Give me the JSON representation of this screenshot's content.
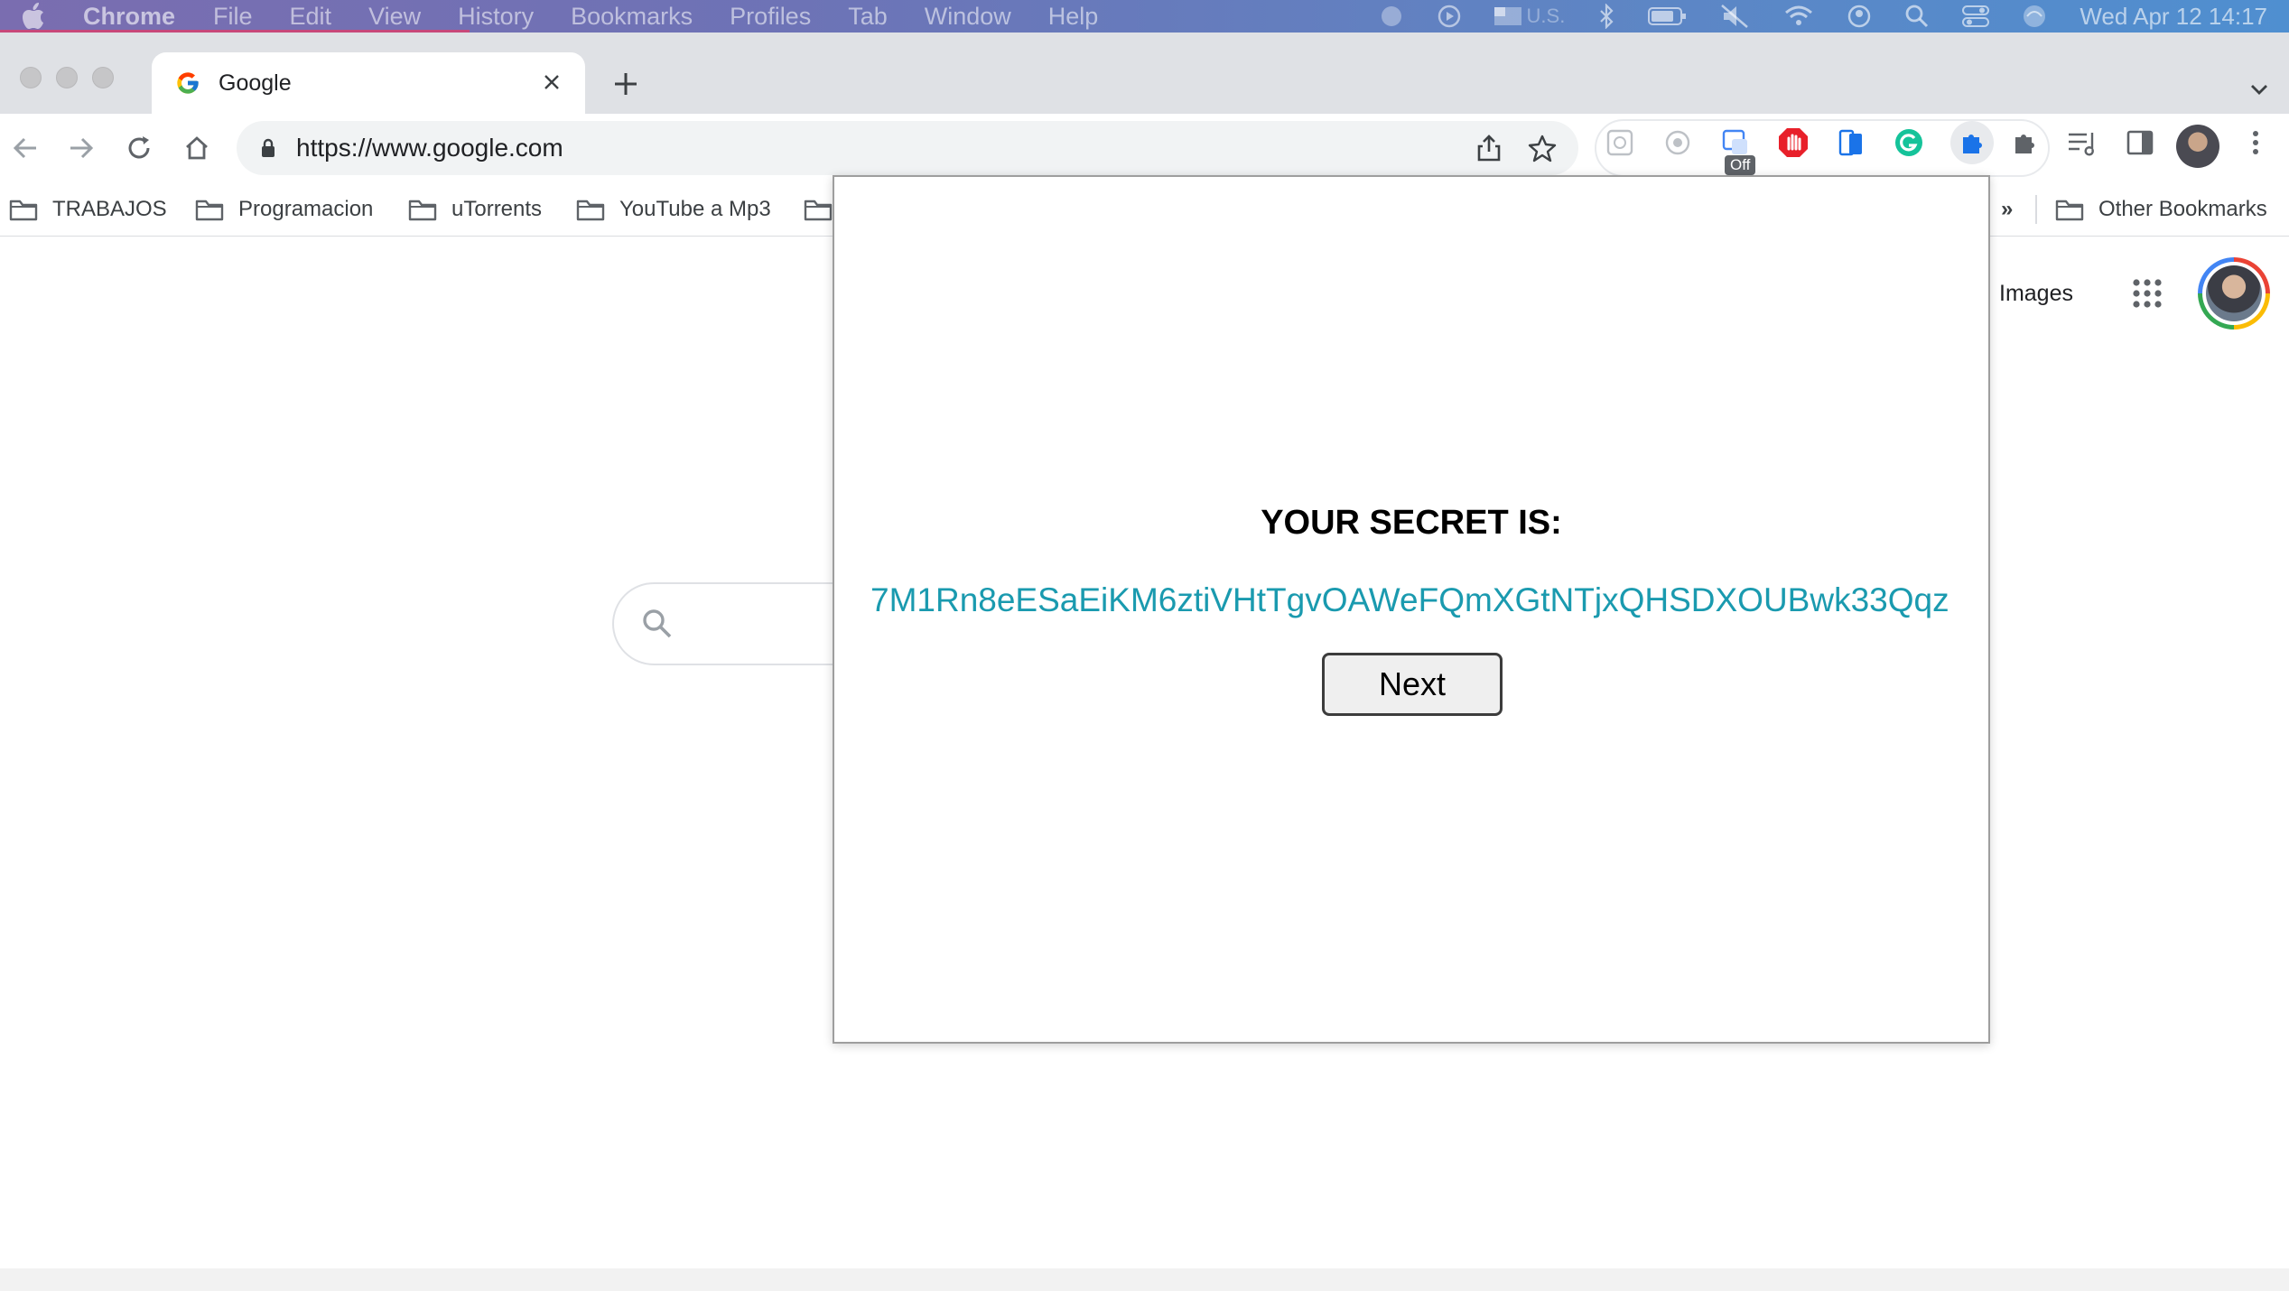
{
  "menubar": {
    "app_name": "Chrome",
    "menus": [
      "File",
      "Edit",
      "View",
      "History",
      "Bookmarks",
      "Profiles",
      "Tab",
      "Window",
      "Help"
    ],
    "input_source": "U.S.",
    "datetime": "Wed Apr 12  14:17"
  },
  "tab": {
    "title": "Google"
  },
  "omnibox": {
    "url": "https://www.google.com"
  },
  "extensions": {
    "off_badge": "Off"
  },
  "bookmarks": {
    "items": [
      "TRABAJOS",
      "Programacion",
      "uTorrents",
      "YouTube a Mp3"
    ],
    "overflow": "»",
    "other": "Other Bookmarks"
  },
  "google": {
    "images_link": "Images"
  },
  "popup": {
    "heading": "YOUR SECRET IS:",
    "secret": "7M1Rn8eESaEiKM6ztiVHtTgvOAWeFQmXGtNTjxQHSDXOUBwk33Qqz...",
    "next_label": "Next"
  },
  "colors": {
    "secret_text": "#1a9aaf",
    "omnibox_bg": "#f1f3f4",
    "tabstrip_bg": "#dfe1e5"
  }
}
